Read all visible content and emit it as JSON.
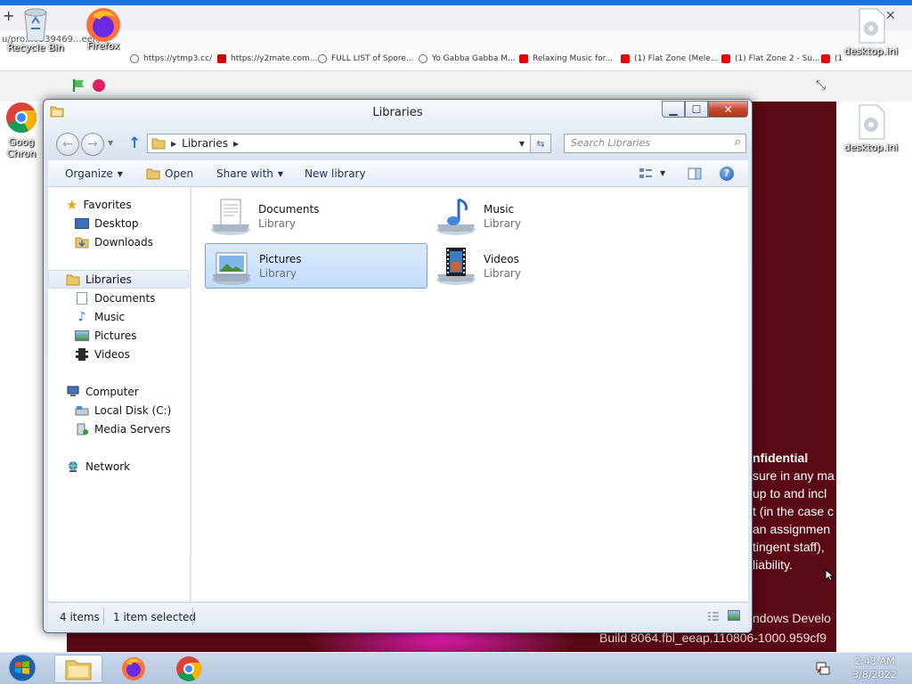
{
  "browser": {
    "address_fragment": "u/pro...6539469...een/",
    "bookmarks": [
      "https://ytmp3.cc/",
      "https://y2mate.com...",
      "FULL LIST of Spore...",
      "Yo Gabba Gabba M...",
      "Relaxing Music for...",
      "(1) Flat Zone (Mele...",
      "(1) Flat Zone 2 - Su...",
      "(1"
    ]
  },
  "desktop": {
    "recycle_bin_label": "Recycle Bin",
    "firefox_label": "Firefox",
    "chrome_label": "Goog Chron",
    "desktop_ini_label": "desktop.ini"
  },
  "background_text": {
    "confidential_lines": [
      "nfidential",
      "sure in any ma",
      "up to and incl",
      "t (in the case c",
      "an assignmen",
      "tingent staff),",
      "liability."
    ],
    "windows_line": "ndows Develo",
    "build_line": "Build 8064.fbl_eeap.110806-1000.959cf9"
  },
  "window": {
    "title": "Libraries",
    "breadcrumb": "Libraries",
    "search_placeholder": "Search Libraries",
    "toolbar": {
      "organize": "Organize",
      "open": "Open",
      "share_with": "Share with",
      "new_library": "New library"
    },
    "nav": {
      "favorites": "Favorites",
      "desktop": "Desktop",
      "downloads": "Downloads",
      "libraries": "Libraries",
      "documents": "Documents",
      "music": "Music",
      "pictures": "Pictures",
      "videos": "Videos",
      "computer": "Computer",
      "local_disk": "Local Disk (C:)",
      "media_servers": "Media Servers",
      "network": "Network"
    },
    "libraries": [
      {
        "name": "Documents",
        "type": "Library"
      },
      {
        "name": "Music",
        "type": "Library"
      },
      {
        "name": "Pictures",
        "type": "Library"
      },
      {
        "name": "Videos",
        "type": "Library"
      }
    ],
    "selected_library": "Pictures",
    "status": {
      "item_count": "4 items",
      "selection": "1 item selected"
    }
  },
  "taskbar": {
    "time": "2:43 AM",
    "date": "3/8/2022"
  },
  "colors": {
    "browser_accent": "#1a73e8",
    "selection_fill": "#c1dcfc",
    "page_background": "#5a0a14"
  }
}
